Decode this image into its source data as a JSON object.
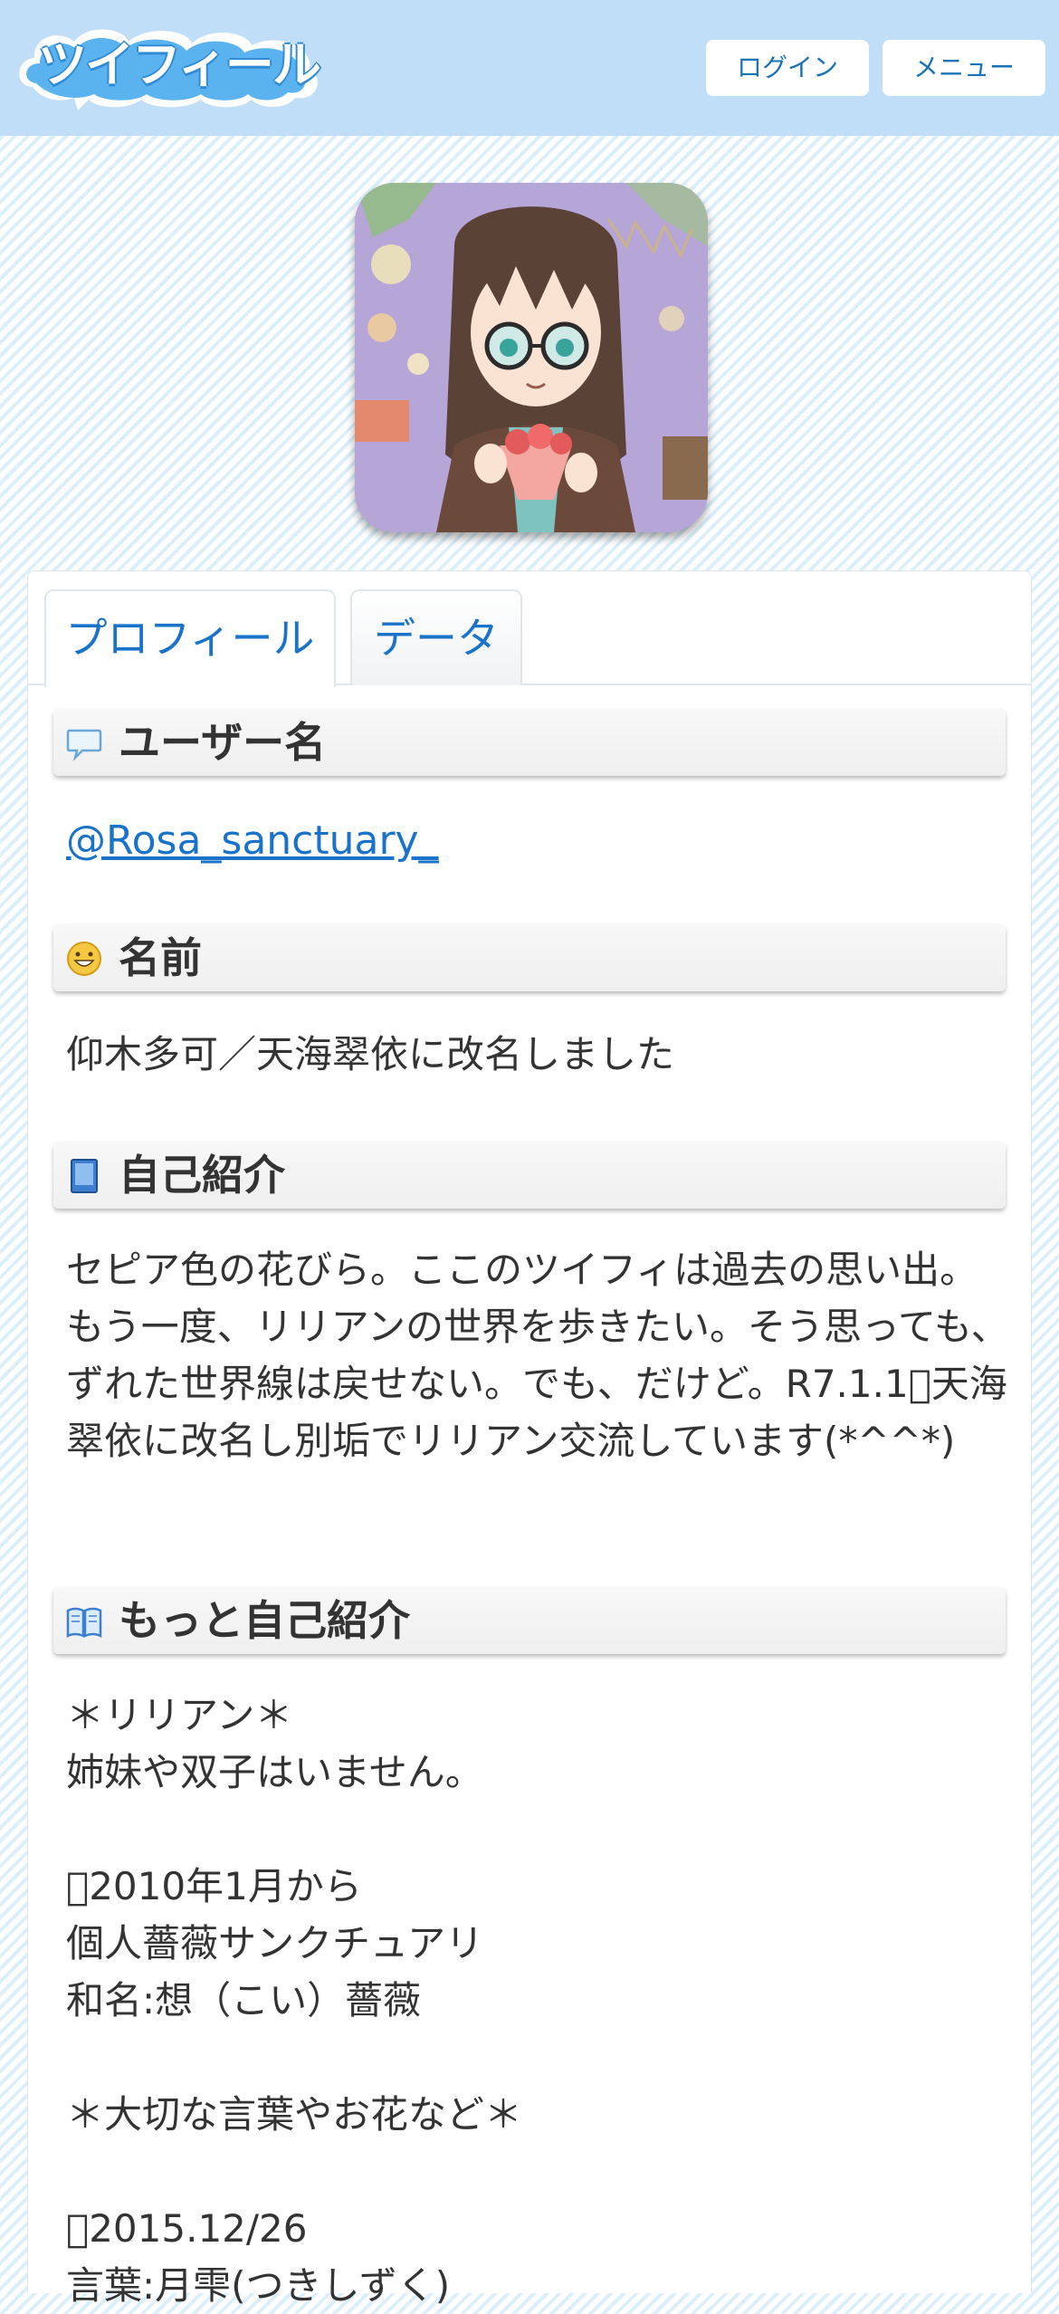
{
  "header": {
    "logo_text": "ツイフィール",
    "login_label": "ログイン",
    "menu_label": "メニュー"
  },
  "tabs": [
    {
      "label": "プロフィール",
      "active": true
    },
    {
      "label": "データ",
      "active": false
    }
  ],
  "sections": {
    "username": {
      "title": "ユーザー名",
      "icon": "speech-bubble-icon",
      "value": "@Rosa_sanctuary_"
    },
    "name": {
      "title": "名前",
      "icon": "smiley-icon",
      "value": "仰木多可／天海翠依に改名しました"
    },
    "intro": {
      "title": "自己紹介",
      "icon": "blue-book-icon",
      "value": "セピア色の花びら。ここのツイフィは過去の思い出。もう一度、リリアンの世界を歩きたい。そう思っても、ずれた世界線は戻せない。でも、だけど。R7.1.1􀀀天海翠依に改名し別垢でリリアン交流しています(*^^*)"
    },
    "more_intro": {
      "title": "もっと自己紹介",
      "icon": "open-book-icon",
      "value": "＊リリアン＊\n姉妹や双子はいません。\n\n􀀀2010年1月から\n個人薔薇サンクチュアリ\n和名:想（こい）薔薇\n\n＊大切な言葉やお花など＊\n\n􀀀2015.12/26\n言葉:月雫(つきしずく)"
    }
  },
  "colors": {
    "header_bg": "#c0def7",
    "link": "#1a73c8",
    "text": "#333333"
  }
}
